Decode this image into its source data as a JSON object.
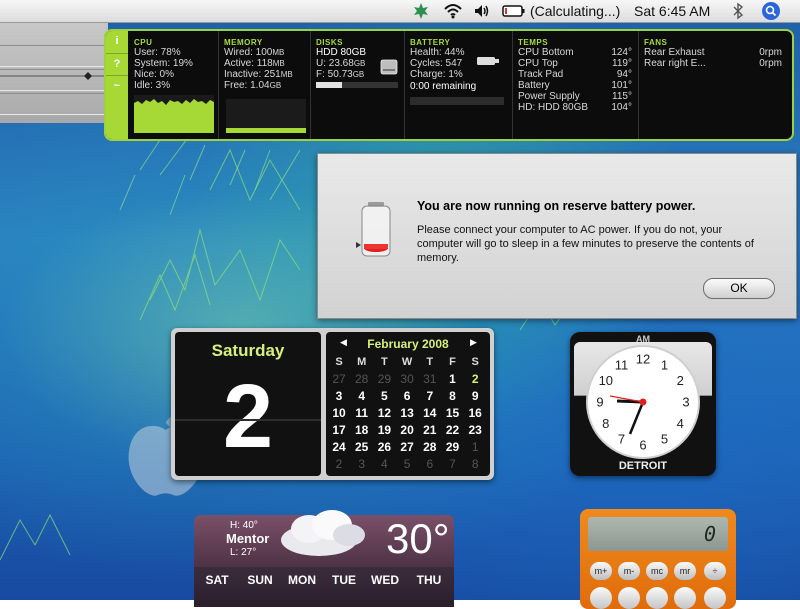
{
  "menubar": {
    "battery_status": "(Calculating...)",
    "clock": "Sat 6:45 AM",
    "icons": [
      "leaf-icon",
      "wifi-icon",
      "volume-icon",
      "battery-icon",
      "bluetooth-icon",
      "spotlight-icon"
    ]
  },
  "istat": {
    "tabs": [
      "i",
      "?",
      "~"
    ],
    "cpu": {
      "title": "CPU",
      "user": "User: 78%",
      "system": "System: 19%",
      "nice": "Nice: 0%",
      "idle": "Idle: 3%"
    },
    "memory": {
      "title": "MEMORY",
      "wired": "Wired: 100",
      "active": "Active: 118",
      "inactive": "Inactive: 251",
      "free": "Free: 1.04",
      "unit_mb": "MB",
      "unit_gb": "GB"
    },
    "disks": {
      "title": "DISKS",
      "name": "HDD 80GB",
      "used": "U: 23.68",
      "free": "F: 50.73",
      "unit": "GB",
      "used_fraction": 0.32
    },
    "battery": {
      "title": "BATTERY",
      "health": "Health: 44%",
      "cycles": "Cycles: 547",
      "charge": "Charge: 1%",
      "remaining": "0:00 remaining"
    },
    "temps": {
      "title": "TEMPS",
      "rows": [
        {
          "label": "CPU Bottom",
          "value": "124°"
        },
        {
          "label": "CPU Top",
          "value": "119°"
        },
        {
          "label": "Track Pad",
          "value": "94°"
        },
        {
          "label": "Battery",
          "value": "101°"
        },
        {
          "label": "Power Supply",
          "value": "115°"
        },
        {
          "label": "HD: HDD 80GB",
          "value": "104°"
        }
      ]
    },
    "fans": {
      "title": "FANS",
      "rows": [
        {
          "label": "Rear Exhaust",
          "value": "0rpm"
        },
        {
          "label": "Rear right E...",
          "value": "0rpm"
        }
      ]
    }
  },
  "alert": {
    "title": "You are now running on reserve battery power.",
    "body": "Please connect your computer to AC power. If you do not, your computer will go to sleep in a few minutes to preserve the contents of memory.",
    "ok_label": "OK"
  },
  "calendar": {
    "day_name": "Saturday",
    "date": "2",
    "month_year": "February 2008",
    "weekdays": [
      "S",
      "M",
      "T",
      "W",
      "T",
      "F",
      "S"
    ],
    "weeks": [
      [
        "27",
        "28",
        "29",
        "30",
        "31",
        "1",
        "2"
      ],
      [
        "3",
        "4",
        "5",
        "6",
        "7",
        "8",
        "9"
      ],
      [
        "10",
        "11",
        "12",
        "13",
        "14",
        "15",
        "16"
      ],
      [
        "17",
        "18",
        "19",
        "20",
        "21",
        "22",
        "23"
      ],
      [
        "24",
        "25",
        "26",
        "27",
        "28",
        "29",
        "1"
      ],
      [
        "2",
        "3",
        "4",
        "5",
        "6",
        "7",
        "8"
      ]
    ]
  },
  "clock": {
    "ampm": "AM",
    "city": "DETROIT",
    "numbers": [
      "12",
      "1",
      "2",
      "3",
      "4",
      "5",
      "6",
      "7",
      "8",
      "9",
      "10",
      "11"
    ]
  },
  "weather": {
    "high": "H: 40°",
    "city": "Mentor",
    "low": "L: 27°",
    "temp": "30°",
    "days": [
      "SAT",
      "SUN",
      "MON",
      "TUE",
      "WED",
      "THU"
    ]
  },
  "calculator": {
    "display": "0",
    "keys": [
      "m+",
      "m-",
      "mc",
      "mr",
      "÷"
    ]
  }
}
